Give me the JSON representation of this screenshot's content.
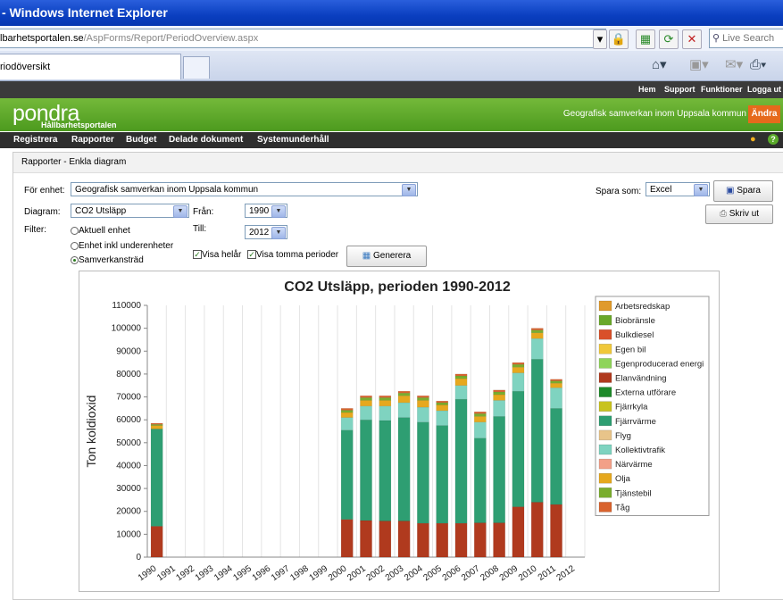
{
  "browser": {
    "title": "- Windows Internet Explorer",
    "address_host": "lbarhetsportalen.se",
    "address_path": "/AspForms/Report/PeriodOverview.aspx",
    "search_placeholder": "Live Search",
    "tab_label": "riodöversikt"
  },
  "header": {
    "top_links": [
      "Hem",
      "Support",
      "Funktioner",
      "Logga ut"
    ],
    "logo": "pondra",
    "logo_sub": "Hållbarhetsportalen",
    "org": "Geografisk samverkan inom Uppsala kommun",
    "change_button": "Ändra"
  },
  "menu": [
    "Registrera",
    "Rapporter",
    "Budget",
    "Delade dokument",
    "Systemunderhåll"
  ],
  "breadcrumb": "Rapporter - Enkla diagram",
  "form": {
    "unit_label": "För enhet:",
    "unit_value": "Geografisk samverkan inom Uppsala kommun",
    "diagram_label": "Diagram:",
    "diagram_value": "CO2 Utsläpp",
    "from_label": "Från:",
    "from_value": "1990",
    "to_label": "Till:",
    "to_value": "2012",
    "filter_label": "Filter:",
    "filters": [
      "Aktuell enhet",
      "Enhet inkl underenheter",
      "Samverkansträd"
    ],
    "selected_filter": 2,
    "check_whole_year": "Visa helår",
    "check_empty": "Visa tomma perioder",
    "generate_button": "Generera",
    "save_as_label": "Spara som:",
    "save_as_value": "Excel",
    "save_button": "Spara",
    "print_button": "Skriv ut"
  },
  "chart_data": {
    "type": "bar",
    "stacked": true,
    "title": "CO2 Utsläpp, perioden 1990-2012",
    "ylabel": "Ton koldioxid",
    "xlabel": "",
    "ylim": [
      0,
      110000
    ],
    "yticks": [
      0,
      10000,
      20000,
      30000,
      40000,
      50000,
      60000,
      70000,
      80000,
      90000,
      100000,
      110000
    ],
    "legend_position": "right",
    "grid": "vertical",
    "categories": [
      "1990",
      "1991",
      "1992",
      "1993",
      "1994",
      "1995",
      "1996",
      "1997",
      "1998",
      "1999",
      "2000",
      "2001",
      "2002",
      "2003",
      "2004",
      "2005",
      "2006",
      "2007",
      "2008",
      "2009",
      "2010",
      "2011",
      "2012"
    ],
    "series": [
      {
        "name": "Arbetsredskap",
        "color": "#e09a2c",
        "values": [
          0,
          0,
          0,
          0,
          0,
          0,
          0,
          0,
          0,
          0,
          0,
          0,
          0,
          0,
          0,
          0,
          0,
          0,
          0,
          0,
          0,
          0,
          0
        ]
      },
      {
        "name": "Biobränsle",
        "color": "#6aa82a",
        "values": [
          0,
          0,
          0,
          0,
          0,
          0,
          0,
          0,
          0,
          0,
          0,
          0,
          0,
          0,
          0,
          0,
          0,
          0,
          0,
          0,
          0,
          0,
          0
        ]
      },
      {
        "name": "Bulkdiesel",
        "color": "#d9502a",
        "values": [
          0,
          0,
          0,
          0,
          0,
          0,
          0,
          0,
          0,
          0,
          0,
          0,
          0,
          0,
          0,
          0,
          0,
          0,
          0,
          0,
          0,
          0,
          0
        ]
      },
      {
        "name": "Egen bil",
        "color": "#f0c83a",
        "values": [
          0,
          0,
          0,
          0,
          0,
          0,
          0,
          0,
          0,
          0,
          0,
          0,
          0,
          0,
          0,
          0,
          0,
          0,
          0,
          0,
          0,
          0,
          0
        ]
      },
      {
        "name": "Egenproducerad energi",
        "color": "#8fd45a",
        "values": [
          0,
          0,
          0,
          0,
          0,
          0,
          0,
          0,
          0,
          0,
          0,
          0,
          0,
          0,
          0,
          0,
          0,
          0,
          0,
          0,
          0,
          0,
          0
        ]
      },
      {
        "name": "Elanvändning",
        "color": "#b03a1e",
        "values": [
          13500,
          0,
          0,
          0,
          0,
          0,
          0,
          0,
          0,
          0,
          16500,
          16000,
          15800,
          15800,
          14800,
          14800,
          14800,
          15000,
          15000,
          22000,
          24000,
          23000,
          0
        ]
      },
      {
        "name": "Externa utförare",
        "color": "#1e8a2a",
        "values": [
          0,
          0,
          0,
          0,
          0,
          0,
          0,
          0,
          0,
          0,
          0,
          0,
          0,
          0,
          0,
          0,
          0,
          0,
          0,
          0,
          0,
          0,
          0
        ]
      },
      {
        "name": "Fjärrkyla",
        "color": "#c8c31e",
        "values": [
          0,
          0,
          0,
          0,
          0,
          0,
          0,
          0,
          0,
          0,
          0,
          0,
          0,
          0,
          0,
          0,
          0,
          0,
          0,
          0,
          0,
          0,
          0
        ]
      },
      {
        "name": "Fjärrvärme",
        "color": "#2e9e72",
        "values": [
          42500,
          0,
          0,
          0,
          0,
          0,
          0,
          0,
          0,
          0,
          39000,
          44000,
          43900,
          45200,
          44200,
          42700,
          54200,
          37000,
          46500,
          50500,
          62500,
          42000,
          0
        ]
      },
      {
        "name": "Flyg",
        "color": "#e8c48a",
        "values": [
          0,
          0,
          0,
          0,
          0,
          0,
          0,
          0,
          0,
          0,
          0,
          0,
          0,
          0,
          0,
          0,
          0,
          0,
          0,
          0,
          0,
          0,
          0
        ]
      },
      {
        "name": "Kollektivtrafik",
        "color": "#7fd3c0",
        "values": [
          0,
          0,
          0,
          0,
          0,
          0,
          0,
          0,
          0,
          0,
          5500,
          6000,
          6300,
          6500,
          6500,
          6500,
          6000,
          7000,
          7000,
          8000,
          9000,
          9000,
          0
        ]
      },
      {
        "name": "Närvärme",
        "color": "#f2a088",
        "values": [
          0,
          0,
          0,
          0,
          0,
          0,
          0,
          0,
          0,
          0,
          0,
          0,
          0,
          0,
          0,
          0,
          0,
          0,
          0,
          0,
          0,
          0,
          0
        ]
      },
      {
        "name": "Olja",
        "color": "#e6a81e",
        "values": [
          1500,
          0,
          0,
          0,
          0,
          0,
          0,
          0,
          0,
          0,
          2200,
          2500,
          2500,
          3000,
          3000,
          2500,
          3000,
          2500,
          2500,
          2500,
          2500,
          2000,
          0
        ]
      },
      {
        "name": "Tjänstebil",
        "color": "#7aad2e",
        "values": [
          500,
          0,
          0,
          0,
          0,
          0,
          0,
          0,
          0,
          0,
          1000,
          1200,
          1200,
          1200,
          1200,
          1000,
          1200,
          1200,
          1200,
          1200,
          1200,
          1000,
          0
        ]
      },
      {
        "name": "Tåg",
        "color": "#d9632e",
        "values": [
          500,
          0,
          0,
          0,
          0,
          0,
          0,
          0,
          0,
          0,
          800,
          800,
          800,
          800,
          800,
          700,
          800,
          800,
          800,
          800,
          800,
          700,
          0
        ]
      }
    ]
  }
}
